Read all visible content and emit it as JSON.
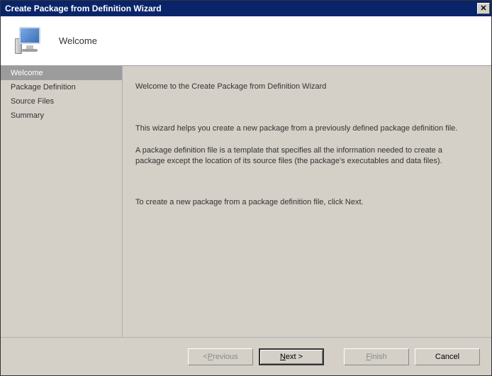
{
  "window": {
    "title": "Create Package from Definition Wizard",
    "close_glyph": "✕"
  },
  "header": {
    "heading": "Welcome"
  },
  "sidebar": {
    "items": [
      {
        "label": "Welcome",
        "active": true
      },
      {
        "label": "Package Definition",
        "active": false
      },
      {
        "label": "Source Files",
        "active": false
      },
      {
        "label": "Summary",
        "active": false
      }
    ]
  },
  "content": {
    "title": "Welcome to the Create Package from Definition Wizard",
    "para1": "This wizard helps you create a new package from a previously defined package definition file.",
    "para2": "A package definition file is a template that specifies all the information needed to create a package except the location of its source files (the package's executables and data files).",
    "para3": "To create a new package from a package definition file, click Next."
  },
  "footer": {
    "previous_prefix": "< ",
    "previous_u": "P",
    "previous_rest": "revious",
    "next_u": "N",
    "next_rest": "ext >",
    "finish_u": "F",
    "finish_rest": "inish",
    "cancel": "Cancel"
  }
}
